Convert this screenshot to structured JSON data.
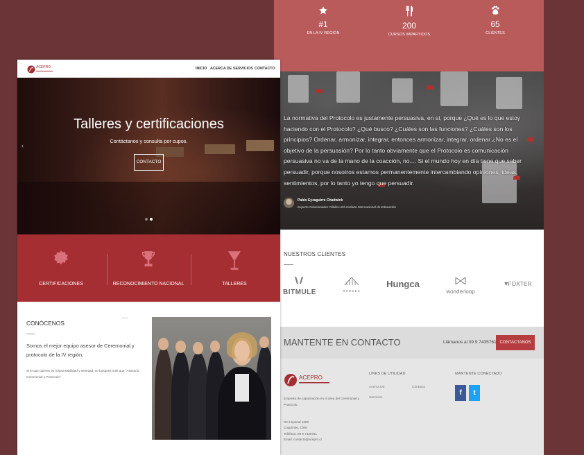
{
  "colors": {
    "background": "#6b3538",
    "accent": "#a52e33",
    "stats_bar": "#b95a5b",
    "button": "#b53d3f"
  },
  "home": {
    "nav": {
      "logo_text": "ACEPRO",
      "items": [
        "INICIO",
        "ACERCA DE",
        "SERVICIOS",
        "CONTACTO"
      ]
    },
    "hero": {
      "title": "Talleres y certificaciones",
      "subtitle": "Contáctanos y consulta por cupos.",
      "button": "CONTACTO",
      "prev_arrow": "‹",
      "slide_count": 2,
      "active_slide": 2
    },
    "features": [
      {
        "icon": "badge-icon",
        "label": "CERTIFICACIONES"
      },
      {
        "icon": "trophy-icon",
        "label": "RECONOCIMIENTO NACIONAL"
      },
      {
        "icon": "cocktail-glass-icon",
        "label": "TALLERES"
      }
    ],
    "about": {
      "title": "CONÓCENOS",
      "lead": "Somos el mejor equipo asesor de Ceremonial y protocolo de la IV región.",
      "text": "Si lo que quieres es responsabilidad y seriedad, no busques más que \"Asesoría Ceremonial y Protocolo\"."
    }
  },
  "page2": {
    "stats": [
      {
        "icon": "star-icon",
        "value": "#1",
        "label": "EN LA IV REGIÓN"
      },
      {
        "icon": "cutlery-icon",
        "value": "200",
        "label": "CURSOS IMPARTIDOS"
      },
      {
        "icon": "paw-icon",
        "value": "65",
        "label": "CLIENTES"
      }
    ],
    "quote": {
      "text": "La normativa del Protocolo es justamente persuasiva, en sí, porque ¿Qué es lo que estoy haciendo con el Protocolo? ¿Qué busco? ¿Cuáles son las funciones? ¿Cuáles son los principios? Ordenar, armonizar, integrar, entonces armonizar, integrar, ordenar ¿No es el objetivo de la persuasión? Por lo tanto obviamente que el Protocolo es comunicación persuasiva no va de la mano de la coacción, no.... Si el mundo hoy en día tiene que saber persuadir, porque nosotros estamos permanentemente intercambiando opiniones, ideas, sentimientos, por lo tanto yo tengo que persuadir.",
      "author": "Pablo Eyzaguirre Chadwick",
      "role": "Experto Relacionador Público del Instituto Internacional de Educación"
    },
    "clients": {
      "title": "NUESTROS CLIENTES",
      "logos": [
        "BITMULE",
        "RHODES",
        "Hungca",
        "wonderloop",
        "FOXTER"
      ]
    },
    "contact": {
      "title": "MANTENTE EN CONTACTO",
      "phone_text": "Llámanos al 09 9 7435761 or",
      "button": "CONTACTANOS"
    },
    "footer": {
      "logo_text": "ACEPRO",
      "description": "Empresa de capacitación en el área del Ceremonial y Protocolo.",
      "address": [
        "Rio Imperial 1690",
        "Coquimbo, Chile",
        "Teléfono: 09 9 7435761",
        "Email: contacto@acepro.cl"
      ],
      "links_title": "LINKS DE UTILIDAD",
      "links": [
        "Acerca De",
        "Contacto",
        "Servicios"
      ],
      "social_title": "MANTENTE CONECTADO",
      "social": [
        {
          "icon": "facebook-icon",
          "glyph": "f",
          "color": "#3b5998"
        },
        {
          "icon": "twitter-icon",
          "glyph": "t",
          "color": "#1da1f2"
        }
      ]
    }
  }
}
